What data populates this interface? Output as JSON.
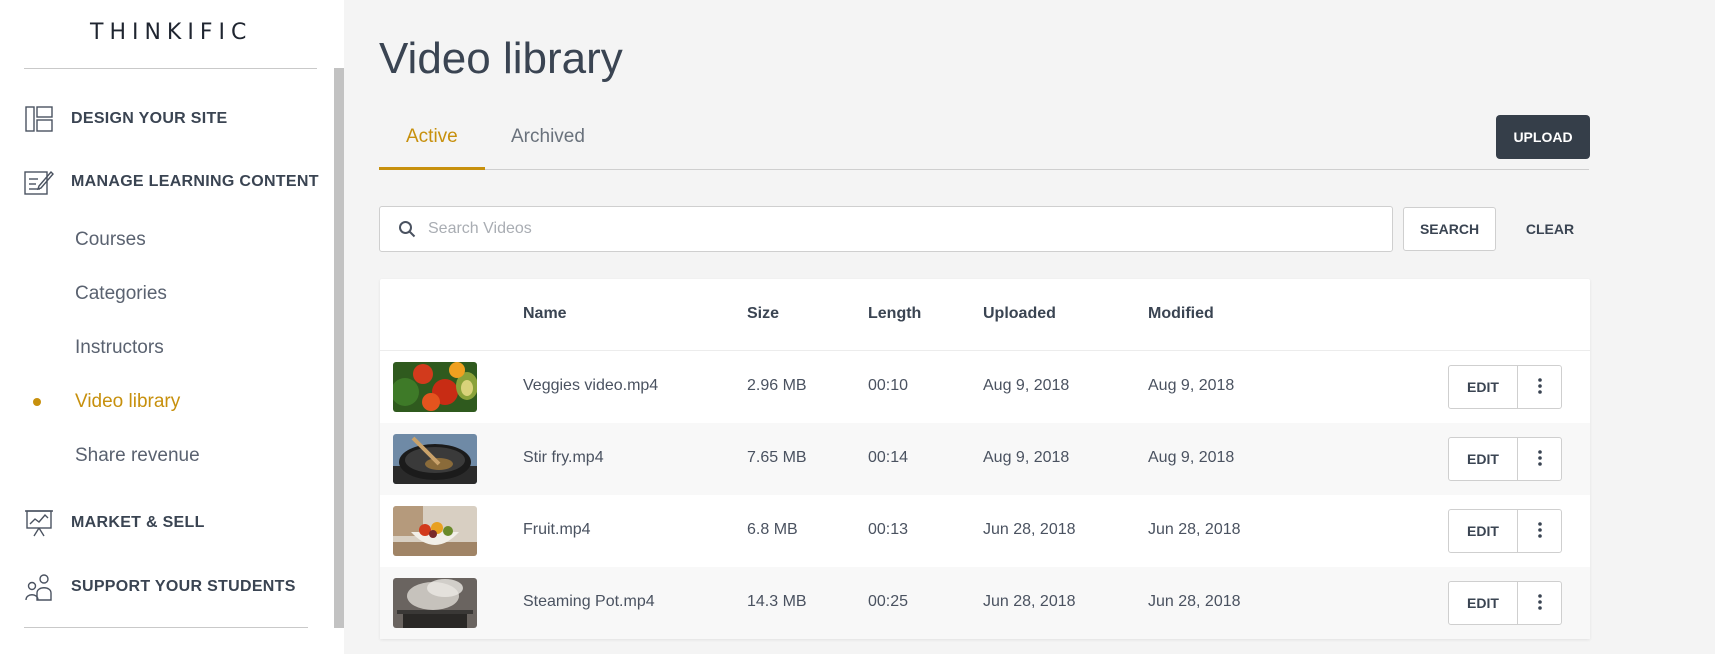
{
  "sidebar": {
    "logo": "THINKIFIC",
    "main_items": [
      {
        "label": "DESIGN YOUR SITE",
        "icon": "layout-icon"
      },
      {
        "label": "MANAGE LEARNING CONTENT",
        "icon": "edit-content-icon"
      },
      {
        "label": "MARKET & SELL",
        "icon": "presentation-chart-icon"
      },
      {
        "label": "SUPPORT YOUR STUDENTS",
        "icon": "students-icon"
      }
    ],
    "sub_items": [
      {
        "label": "Courses",
        "active": false
      },
      {
        "label": "Categories",
        "active": false
      },
      {
        "label": "Instructors",
        "active": false
      },
      {
        "label": "Video library",
        "active": true
      },
      {
        "label": "Share revenue",
        "active": false
      }
    ]
  },
  "main": {
    "title": "Video library",
    "tabs": [
      {
        "label": "Active",
        "active": true
      },
      {
        "label": "Archived",
        "active": false
      }
    ],
    "upload_label": "UPLOAD",
    "search": {
      "placeholder": "Search Videos",
      "value": ""
    },
    "search_label": "SEARCH",
    "clear_label": "CLEAR",
    "table": {
      "headers": [
        "Name",
        "Size",
        "Length",
        "Uploaded",
        "Modified"
      ],
      "rows": [
        {
          "name": "Veggies video.mp4",
          "size": "2.96 MB",
          "length": "00:10",
          "uploaded": "Aug 9, 2018",
          "modified": "Aug 9, 2018",
          "thumb": "vegetables-thumbnail"
        },
        {
          "name": "Stir fry.mp4",
          "size": "7.65 MB",
          "length": "00:14",
          "uploaded": "Aug 9, 2018",
          "modified": "Aug 9, 2018",
          "thumb": "wok-thumbnail"
        },
        {
          "name": "Fruit.mp4",
          "size": "6.8 MB",
          "length": "00:13",
          "uploaded": "Jun 28, 2018",
          "modified": "Jun 28, 2018",
          "thumb": "fruit-bowl-thumbnail"
        },
        {
          "name": "Steaming Pot.mp4",
          "size": "14.3 MB",
          "length": "00:25",
          "uploaded": "Jun 28, 2018",
          "modified": "Jun 28, 2018",
          "thumb": "steaming-pot-thumbnail"
        }
      ],
      "edit_label": "EDIT"
    }
  },
  "colors": {
    "accent": "#c7900d",
    "dark_button": "#353e49",
    "text": "#3a4452",
    "background": "#f4f4f4"
  }
}
